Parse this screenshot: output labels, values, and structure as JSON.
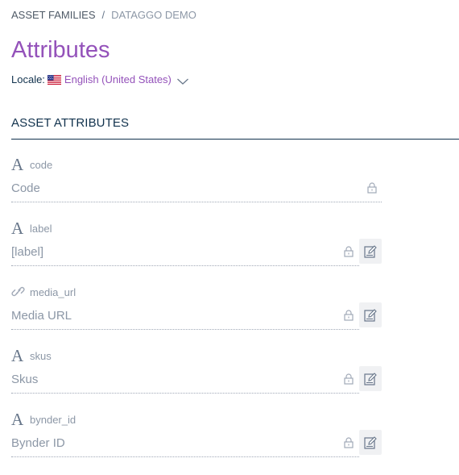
{
  "breadcrumb": {
    "items": [
      "ASSET FAMILIES",
      "DATAGGO DEMO"
    ],
    "separator": "/"
  },
  "page_title": "Attributes",
  "locale": {
    "label": "Locale:",
    "value": "English (United States)",
    "flag": "us-flag-icon"
  },
  "section": {
    "title": "ASSET ATTRIBUTES"
  },
  "attributes": [
    {
      "type_icon": "text-type-icon",
      "type_glyph": "A",
      "code": "code",
      "label": "Code",
      "locked": true,
      "editable": false
    },
    {
      "type_icon": "text-type-icon",
      "type_glyph": "A",
      "code": "label",
      "label": "[label]",
      "locked": true,
      "editable": true
    },
    {
      "type_icon": "link-type-icon",
      "type_glyph": "",
      "code": "media_url",
      "label": "Media URL",
      "locked": true,
      "editable": true
    },
    {
      "type_icon": "text-type-icon",
      "type_glyph": "A",
      "code": "skus",
      "label": "Skus",
      "locked": true,
      "editable": true
    },
    {
      "type_icon": "text-type-icon",
      "type_glyph": "A",
      "code": "bynder_id",
      "label": "Bynder ID",
      "locked": true,
      "editable": true
    }
  ],
  "colors": {
    "accent": "#9452ba",
    "text_dark": "#11324d",
    "text_muted": "#8c97a6",
    "edit_button_bg": "#f0f1f3"
  }
}
